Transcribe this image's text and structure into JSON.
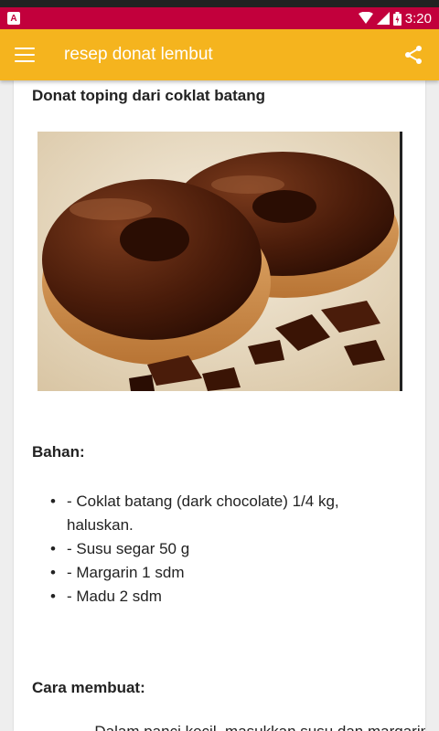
{
  "status": {
    "notif_letter": "A",
    "time": "3:20",
    "bar_color": "#c2003c"
  },
  "appbar": {
    "title": "resep donat lembut",
    "color": "#f5b41e",
    "menu_icon": "hamburger-menu-icon",
    "share_icon": "share-icon"
  },
  "post": {
    "title": "Donat toping dari coklat batang",
    "image": "chocolate-glazed-donuts-photo",
    "ingredients_heading": "Bahan:",
    "ingredients": [
      "- Coklat batang (dark chocolate) 1/4 kg, haluskan.",
      "- Susu segar 50 g",
      "- Margarin 1 sdm",
      "- Madu 2 sdm"
    ],
    "method_heading": "Cara membuat:",
    "method_first_line": "- Dalam panci kecil, masukkan susu dan margarin. Kemudian"
  }
}
